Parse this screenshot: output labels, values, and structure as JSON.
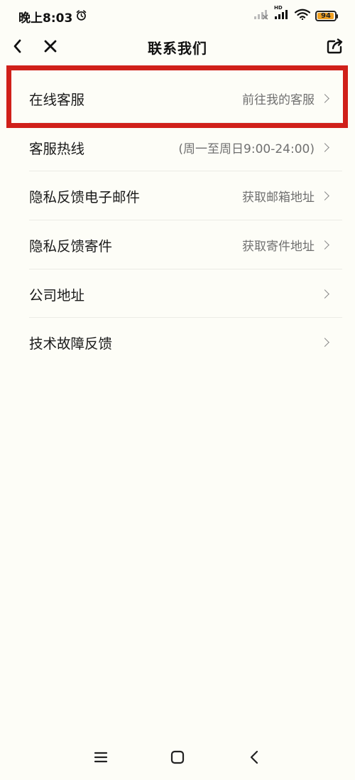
{
  "status_bar": {
    "time": "晚上8:03",
    "network_label": "HD",
    "battery_level": "94",
    "battery_color": "#f0a022"
  },
  "nav": {
    "title": "联系我们",
    "back_icon": "chevron-left-icon",
    "close_icon": "close-icon",
    "share_icon": "share-icon"
  },
  "rows": [
    {
      "label": "在线客服",
      "value": "前往我的客服"
    },
    {
      "label": "客服热线",
      "value": "(周一至周日9:00-24:00)"
    },
    {
      "label": "隐私反馈电子邮件",
      "value": "获取邮箱地址"
    },
    {
      "label": "隐私反馈寄件",
      "value": "获取寄件地址"
    },
    {
      "label": "公司地址",
      "value": ""
    },
    {
      "label": "技术故障反馈",
      "value": ""
    }
  ],
  "highlight_color": "#d0201a",
  "system_nav": {
    "menu_icon": "menu-icon",
    "home_icon": "home-icon",
    "back_icon": "back-icon"
  }
}
